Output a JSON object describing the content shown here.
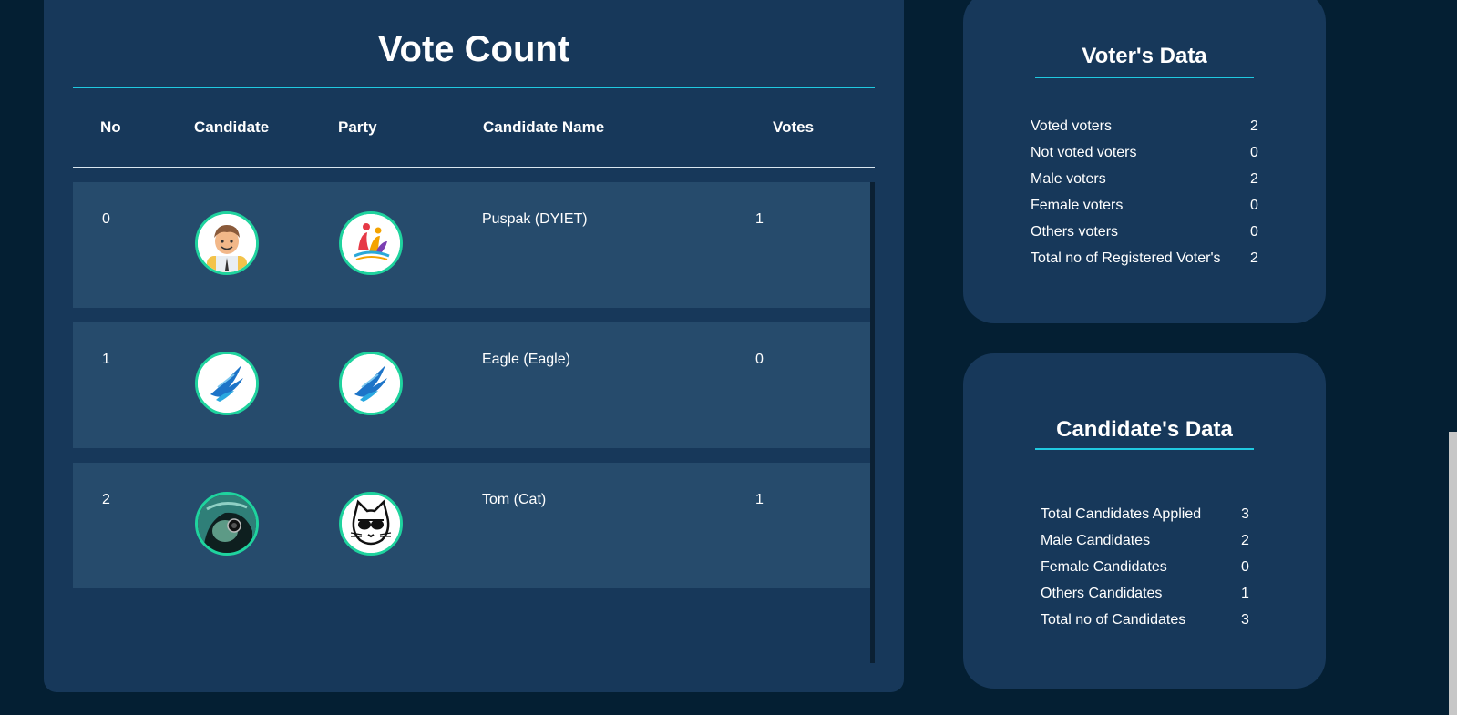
{
  "vote_count": {
    "title": "Vote Count",
    "headers": {
      "no": "No",
      "candidate": "Candidate",
      "party": "Party",
      "candidate_name": "Candidate Name",
      "votes": "Votes"
    },
    "rows": [
      {
        "no": "0",
        "candidate_name": "Puspak (DYIET)",
        "votes": "1",
        "candidate_icon": "man-avatar-icon",
        "party_icon": "people-logo-icon"
      },
      {
        "no": "1",
        "candidate_name": "Eagle (Eagle)",
        "votes": "0",
        "candidate_icon": "eagle-logo-icon",
        "party_icon": "eagle-logo-icon"
      },
      {
        "no": "2",
        "candidate_name": "Tom (Cat)",
        "votes": "1",
        "candidate_icon": "hooded-figure-icon",
        "party_icon": "cat-sunglasses-icon"
      }
    ]
  },
  "voters_data": {
    "title": "Voter's Data",
    "items": [
      {
        "label": "Voted voters",
        "value": "2"
      },
      {
        "label": "Not voted voters",
        "value": "0"
      },
      {
        "label": "Male voters",
        "value": "2"
      },
      {
        "label": "Female voters",
        "value": "0"
      },
      {
        "label": "Others voters",
        "value": "0"
      },
      {
        "label": "Total no of Registered Voter's",
        "value": "2"
      }
    ]
  },
  "candidates_data": {
    "title": "Candidate's Data",
    "items": [
      {
        "label": "Total Candidates Applied",
        "value": "3"
      },
      {
        "label": "Male Candidates",
        "value": "2"
      },
      {
        "label": "Female Candidates",
        "value": "0"
      },
      {
        "label": "Others Candidates",
        "value": "1"
      },
      {
        "label": "Total no of Candidates",
        "value": "3"
      }
    ]
  },
  "colors": {
    "background": "#041f33",
    "panel": "#17385a",
    "row": "#264b6c",
    "accent": "#20c9e0",
    "avatar_border": "#1fd39e"
  }
}
